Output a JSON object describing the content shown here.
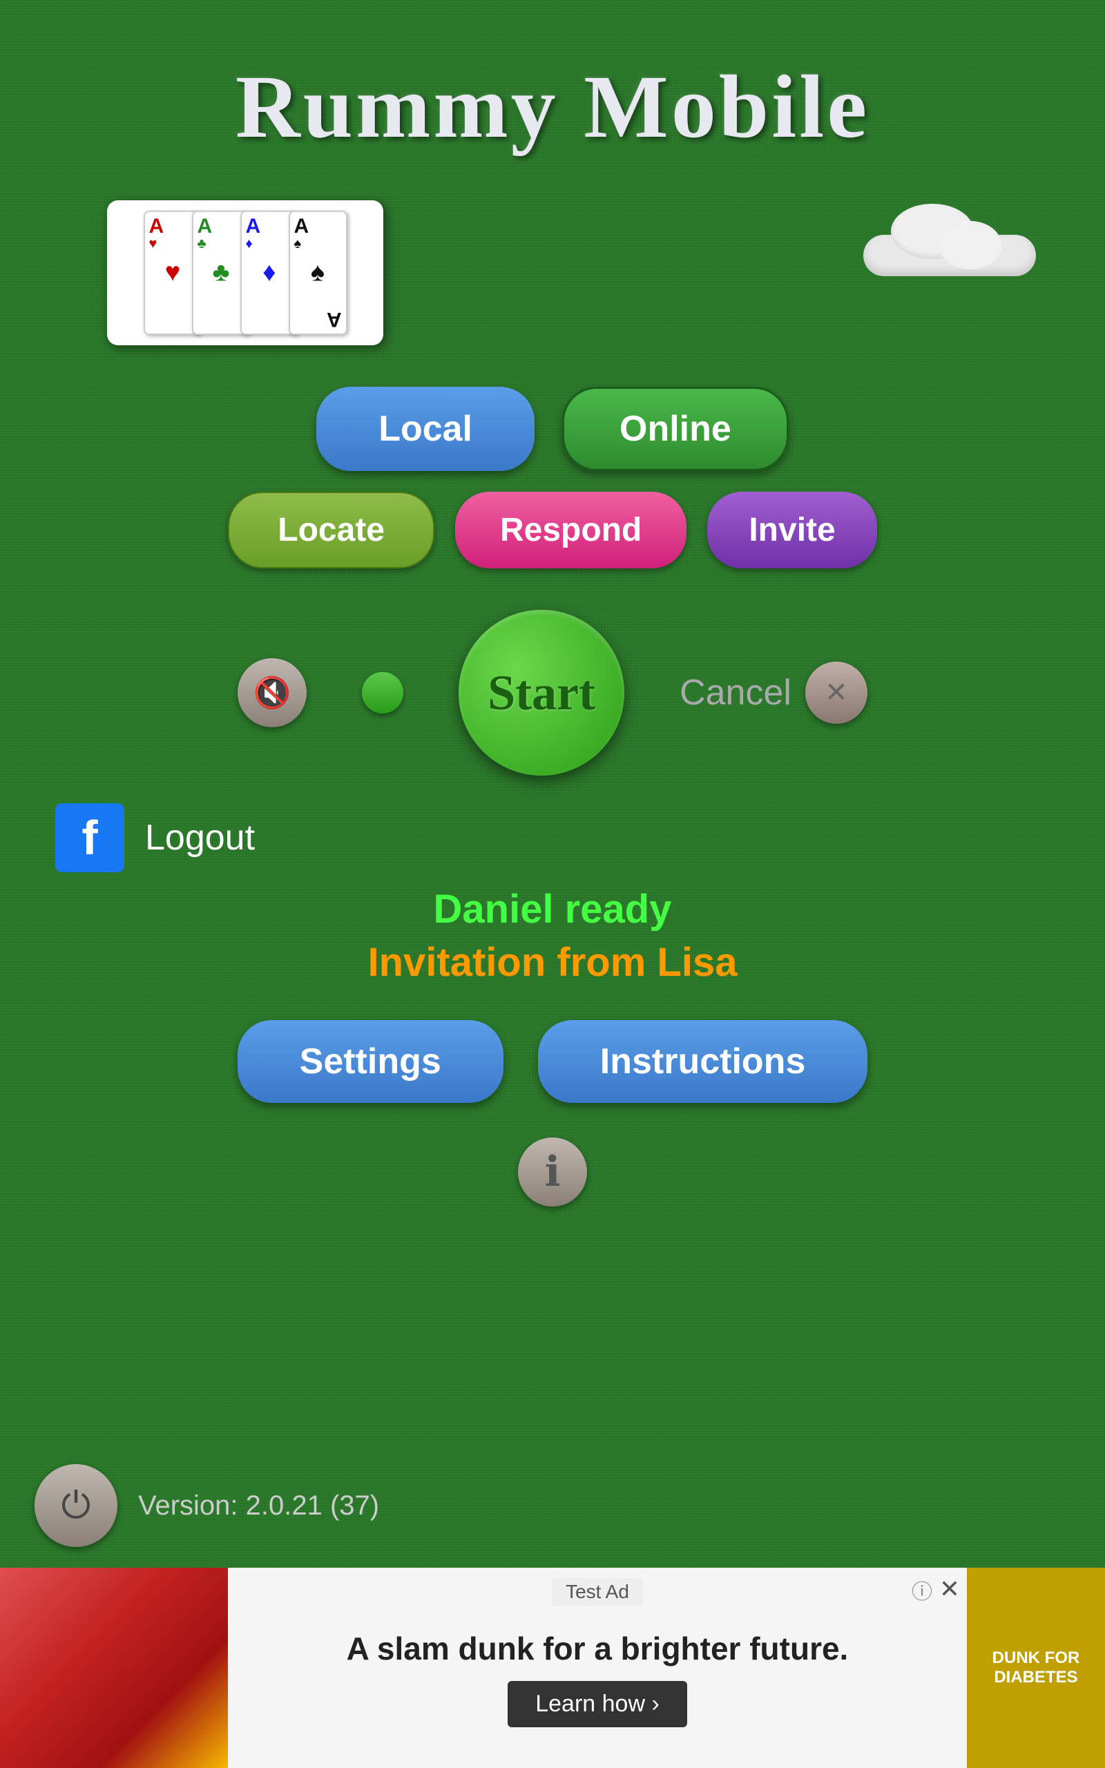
{
  "app": {
    "title": "Rummy Mobile"
  },
  "buttons": {
    "local": "Local",
    "online": "Online",
    "locate": "Locate",
    "respond": "Respond",
    "invite": "Invite",
    "start": "Start",
    "cancel": "Cancel",
    "logout": "Logout",
    "settings": "Settings",
    "instructions": "Instructions"
  },
  "status": {
    "player_ready": "Daniel ready",
    "invitation": "Invitation from Lisa"
  },
  "version": {
    "text": "Version: 2.0.21 (37)"
  },
  "ad": {
    "test_label": "Test Ad",
    "text": "A slam dunk for a brighter future.",
    "learn_more": "Learn how ›",
    "logo_text": "DUNK FOR\nDIABETES"
  },
  "cards": [
    {
      "rank": "A",
      "suit": "♥",
      "color": "#cc0000"
    },
    {
      "rank": "A",
      "suit": "♣",
      "color": "#228b22"
    },
    {
      "rank": "A",
      "suit": "♦",
      "color": "#1a1aee"
    },
    {
      "rank": "A",
      "suit": "♠",
      "color": "#111111"
    }
  ],
  "icons": {
    "mute": "🔇",
    "info": "ℹ",
    "power": "⏻",
    "close": "✕",
    "facebook": "f"
  }
}
